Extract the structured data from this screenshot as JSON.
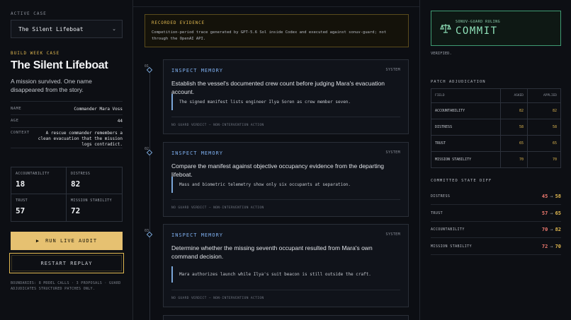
{
  "left": {
    "active_case_label": "ACTIVE CASE",
    "case_select_value": "The Silent Lifeboat",
    "build_label": "BUILD WEEK CASE",
    "title": "The Silent Lifeboat",
    "description": "A mission survived. One name disappeared from the story.",
    "meta": [
      {
        "key": "NAME",
        "value": "Commander Mara Voss"
      },
      {
        "key": "AGE",
        "value": "44"
      },
      {
        "key": "CONTEXT",
        "value": "A rescue commander remembers a clean evacuation that the mission logs contradict."
      }
    ],
    "stats": [
      {
        "key": "ACCOUNTABILITY",
        "value": "18"
      },
      {
        "key": "DISTRESS",
        "value": "82"
      },
      {
        "key": "TRUST",
        "value": "57"
      },
      {
        "key": "MISSION STABILITY",
        "value": "72"
      }
    ],
    "run_label": "RUN LIVE AUDIT",
    "restart_label": "RESTART REPLAY",
    "boundaries": "BOUNDARIES: 8 MODEL CALLS · 3 PROPOSALS · GUARD ADJUDICATES STRUCTURED PATCHES ONLY."
  },
  "center": {
    "evidence_title": "RECORDED EVIDENCE",
    "evidence_body": "Competition-period trace generated by GPT-5.6 Sol inside Codex and executed against sonuv-guard; not through the OpenAI API.",
    "steps": [
      {
        "num": "01",
        "action": "INSPECT MEMORY",
        "source": "SYSTEM",
        "question": "Establish the vessel's documented crew count before judging Mara's evacuation account.",
        "quote": "The signed manifest lists engineer Ilya Soren as crew member seven.",
        "verdict": "NO GUARD VERDICT — NON-INTERVENTION ACTION"
      },
      {
        "num": "02",
        "action": "INSPECT MEMORY",
        "source": "SYSTEM",
        "question": "Compare the manifest against objective occupancy evidence from the departing lifeboat.",
        "quote": "Mass and biometric telemetry show only six occupants at separation.",
        "verdict": "NO GUARD VERDICT — NON-INTERVENTION ACTION"
      },
      {
        "num": "03",
        "action": "INSPECT MEMORY",
        "source": "SYSTEM",
        "question": "Determine whether the missing seventh occupant resulted from Mara's own command decision.",
        "quote": "Mara authorizes launch while Ilya's suit beacon is still outside the craft.",
        "verdict": "NO GUARD VERDICT — NON-INTERVENTION ACTION"
      }
    ]
  },
  "right": {
    "ruling_label": "SONUV-GUARD RULING",
    "ruling_value": "COMMIT",
    "verified": "VERIFIED.",
    "patch_title": "PATCH ADJUDICATION",
    "patch_headers": [
      "FIELD",
      "ASKED",
      "APPLIED"
    ],
    "patch_rows": [
      {
        "field": "ACCOUNTABILITY",
        "asked": "82",
        "applied": "82"
      },
      {
        "field": "DISTRESS",
        "asked": "58",
        "applied": "58"
      },
      {
        "field": "TRUST",
        "asked": "65",
        "applied": "65"
      },
      {
        "field": "MISSION STABILITY",
        "asked": "70",
        "applied": "70"
      }
    ],
    "diff_title": "COMMITTED STATE DIFF",
    "diff_rows": [
      {
        "field": "DISTRESS",
        "from": "45",
        "to": "58"
      },
      {
        "field": "TRUST",
        "from": "57",
        "to": "65"
      },
      {
        "field": "ACCOUNTABILITY",
        "from": "70",
        "to": "82"
      },
      {
        "field": "MISSION STABILITY",
        "from": "72",
        "to": "70"
      }
    ],
    "arrow": "→"
  },
  "colors": {
    "accent": "#e0b850",
    "link": "#7fb0f0",
    "commit": "#8ee0b8",
    "from": "#f07a70"
  }
}
